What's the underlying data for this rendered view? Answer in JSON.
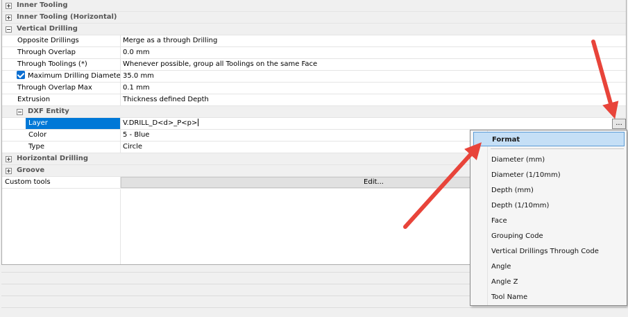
{
  "grid": {
    "categories": {
      "inner_tooling": "Inner Tooling",
      "inner_tooling_horizontal": "Inner Tooling (Horizontal)",
      "vertical_drilling": "Vertical Drilling",
      "dxf_entity": "DXF Entity",
      "horizontal_drilling": "Horizontal Drilling",
      "groove": "Groove"
    },
    "vertical_drilling": {
      "opposite_drillings": {
        "name": "Opposite Drillings",
        "value": "Merge as a through Drilling"
      },
      "through_overlap": {
        "name": "Through Overlap",
        "value": "0.0 mm"
      },
      "through_toolings": {
        "name": "Through Toolings (*)",
        "value": "Whenever possible, group all Toolings on the same Face"
      },
      "max_drilling_diameter": {
        "name": "Maximum Drilling Diameter",
        "value": "35.0 mm",
        "checked": true
      },
      "through_overlap_max": {
        "name": "Through Overlap Max",
        "value": "0.1 mm"
      },
      "extrusion": {
        "name": "Extrusion",
        "value": "Thickness defined Depth"
      }
    },
    "dxf_entity": {
      "layer": {
        "name": "Layer",
        "value": "V.DRILL_D<d>_P<p>",
        "button": "..."
      },
      "color": {
        "name": "Color",
        "value": "5 - Blue"
      },
      "type": {
        "name": "Type",
        "value": "Circle"
      }
    },
    "custom_tools": {
      "name": "Custom tools",
      "button": "Edit..."
    }
  },
  "menu": {
    "header": "Format",
    "items": [
      "Diameter (mm)",
      "Diameter (1/10mm)",
      "Depth (mm)",
      "Depth (1/10mm)",
      "Face",
      "Grouping Code",
      "Vertical Drillings Through Code",
      "Angle",
      "Angle Z",
      "Tool Name"
    ]
  },
  "colors": {
    "selection": "#0078d7",
    "arrow": "#e8443a",
    "menu_highlight": "#c5dff6",
    "checkbox": "#0a6ed1"
  }
}
